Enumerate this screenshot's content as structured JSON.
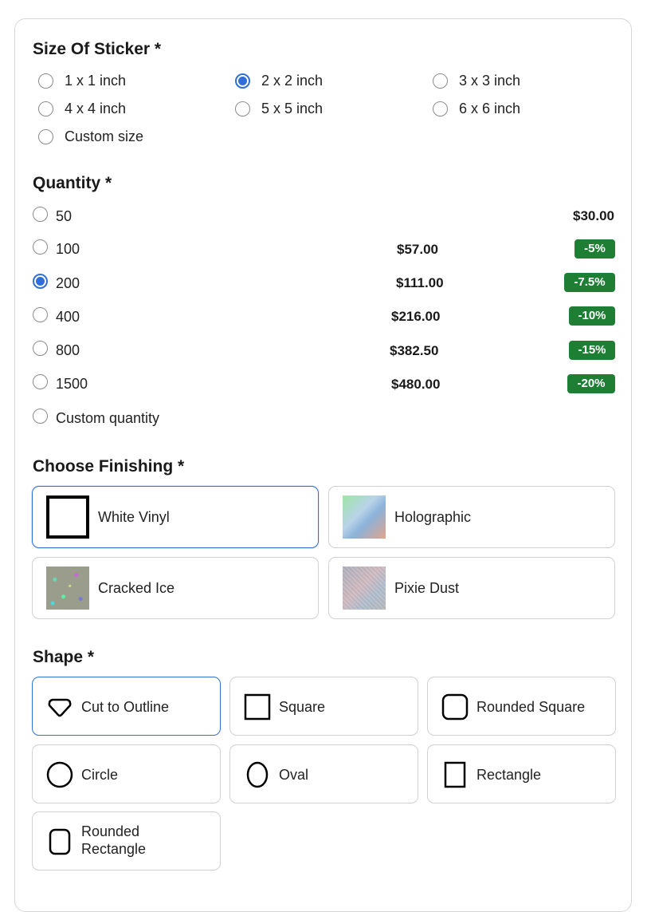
{
  "size": {
    "title": "Size Of Sticker *",
    "options": [
      {
        "label": "1 x 1 inch",
        "checked": false
      },
      {
        "label": "2 x 2 inch",
        "checked": true
      },
      {
        "label": "3 x 3 inch",
        "checked": false
      },
      {
        "label": "4 x 4 inch",
        "checked": false
      },
      {
        "label": "5 x 5 inch",
        "checked": false
      },
      {
        "label": "6 x 6 inch",
        "checked": false
      },
      {
        "label": "Custom size",
        "checked": false
      }
    ]
  },
  "quantity": {
    "title": "Quantity *",
    "options": [
      {
        "label": "50",
        "price": "",
        "badge": "$30.00",
        "checked": false
      },
      {
        "label": "100",
        "price": "$57.00",
        "badge": "-5%",
        "checked": false
      },
      {
        "label": "200",
        "price": "$111.00",
        "badge": "-7.5%",
        "checked": true
      },
      {
        "label": "400",
        "price": "$216.00",
        "badge": "-10%",
        "checked": false
      },
      {
        "label": "800",
        "price": "$382.50",
        "badge": "-15%",
        "checked": false
      },
      {
        "label": "1500",
        "price": "$480.00",
        "badge": "-20%",
        "checked": false
      },
      {
        "label": "Custom quantity",
        "price": "",
        "badge": "",
        "checked": false
      }
    ]
  },
  "finishing": {
    "title": "Choose Finishing *",
    "options": [
      {
        "label": "White Vinyl",
        "swatch": "white",
        "selected": true
      },
      {
        "label": "Holographic",
        "swatch": "holo",
        "selected": false
      },
      {
        "label": "Cracked Ice",
        "swatch": "ice",
        "selected": false
      },
      {
        "label": "Pixie Dust",
        "swatch": "pixie",
        "selected": false
      }
    ]
  },
  "shape": {
    "title": "Shape *",
    "options": [
      {
        "label": "Cut to Outline",
        "icon": "cut-outline-icon",
        "selected": true
      },
      {
        "label": "Square",
        "icon": "square-icon",
        "selected": false
      },
      {
        "label": "Rounded Square",
        "icon": "rounded-square-icon",
        "selected": false
      },
      {
        "label": "Circle",
        "icon": "circle-icon",
        "selected": false
      },
      {
        "label": "Oval",
        "icon": "oval-icon",
        "selected": false
      },
      {
        "label": "Rectangle",
        "icon": "rectangle-icon",
        "selected": false
      },
      {
        "label": "Rounded Rectangle",
        "icon": "rounded-rectangle-icon",
        "selected": false
      }
    ]
  },
  "colors": {
    "accent": "#2f6fd6",
    "badge": "#1e7e34"
  }
}
